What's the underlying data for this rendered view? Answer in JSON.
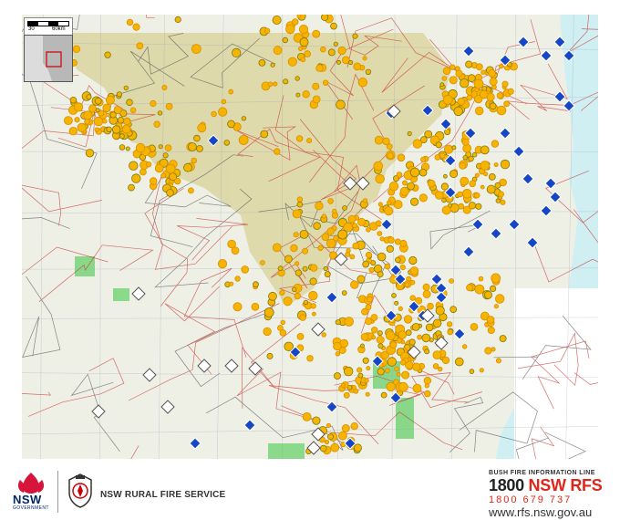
{
  "scale": {
    "left_label": "30",
    "right_label": "60km"
  },
  "legend": {
    "fire_color": "#f6b400",
    "fire_dark_color": "#7a7a12",
    "burnt_area_color": "#ddd8a8",
    "incident_icon_color": "#1646c8",
    "advice_icon_color": "#ffffff",
    "ocean_color": "#cfeff3",
    "park_color": "#7fd67f"
  },
  "footer": {
    "nsw_label": "NSW",
    "nsw_sub": "GOVERNMENT",
    "rfs_name": "NSW RURAL FIRE SERVICE",
    "info_line": "BUSH FIRE INFORMATION LINE",
    "info_big_prefix": "1800 ",
    "info_big_brand": "NSW RFS",
    "info_number": "1800 679 737",
    "url": "www.rfs.nsw.gov.au"
  }
}
